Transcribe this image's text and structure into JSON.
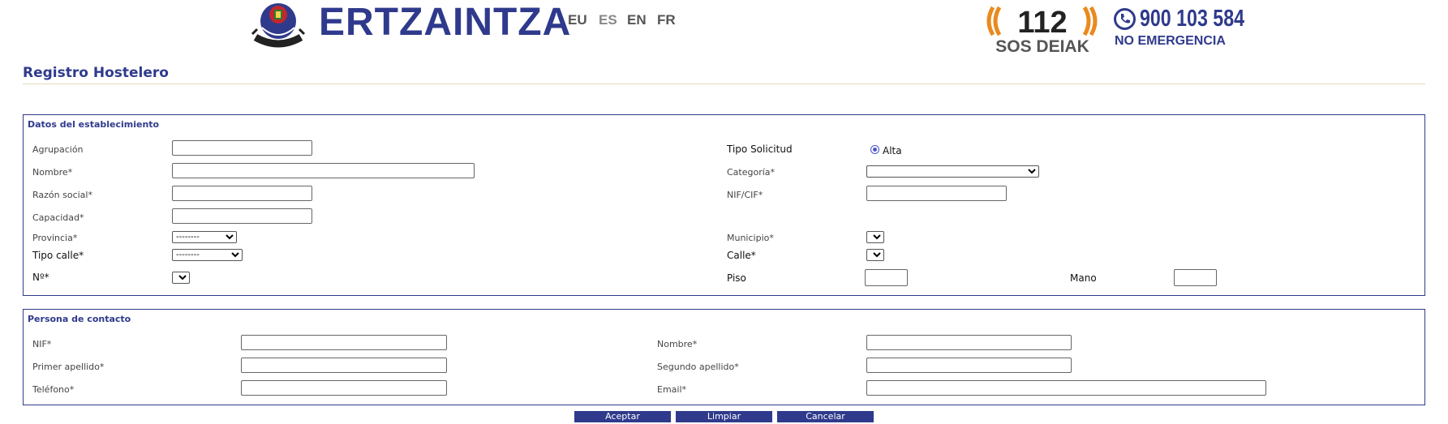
{
  "header": {
    "brand_name": "ERTZAINTZA",
    "emblem_text": "ERTZAINTZA",
    "languages": [
      "EU",
      "ES",
      "EN",
      "FR"
    ],
    "sos_number": "112",
    "sos_label": "SOS DEIAK",
    "phone_number": "900 103 584",
    "phone_label": "NO EMERGENCIA"
  },
  "page": {
    "title": "Registro Hostelero"
  },
  "establishment": {
    "legend": "Datos del establecimiento",
    "agrupacion_label": "Agrupación",
    "nombre_label": "Nombre*",
    "razon_social_label": "Razón social*",
    "capacidad_label": "Capacidad*",
    "provincia_label": "Provincia*",
    "provincia_value": "--------",
    "tipo_calle_label": "Tipo calle*",
    "tipo_calle_value": "--------",
    "numero_label": "Nº*",
    "tipo_solicitud_label": "Tipo Solicitud",
    "tipo_solicitud_option": "Alta",
    "categoria_label": "Categoría*",
    "nif_cif_label": "NIF/CIF*",
    "municipio_label": "Municipio*",
    "calle_label": "Calle*",
    "piso_label": "Piso",
    "mano_label": "Mano"
  },
  "contact": {
    "legend": "Persona de contacto",
    "nif_label": "NIF*",
    "primer_apellido_label": "Primer apellido*",
    "telefono_label": "Teléfono*",
    "nombre_label": "Nombre*",
    "segundo_apellido_label": "Segundo apellido*",
    "email_label": "Email*"
  },
  "actions": {
    "accept": "Aceptar",
    "clear": "Limpiar",
    "cancel": "Cancelar"
  },
  "colors": {
    "brand_blue": "#2f3a8c",
    "sos_orange": "#e98a1f",
    "radio_blue": "#4b56c8"
  }
}
